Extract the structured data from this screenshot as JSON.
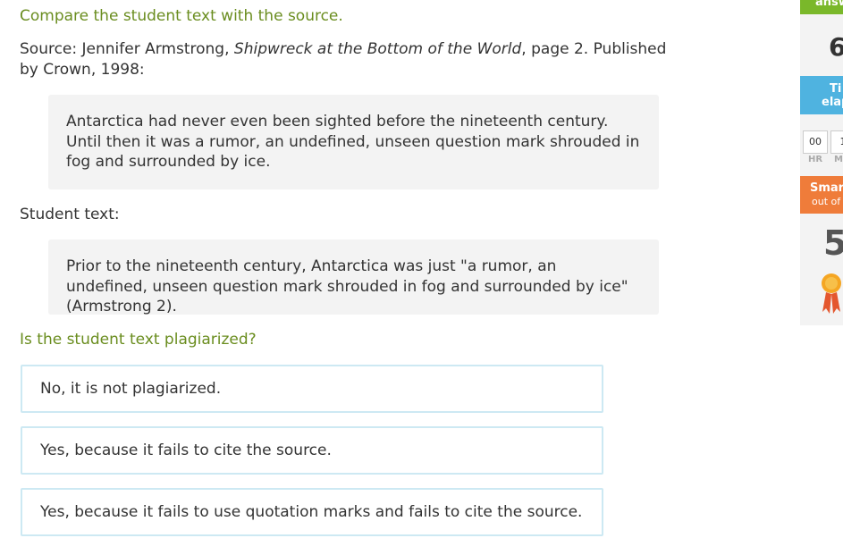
{
  "prompt": "Compare the student text with the source.",
  "source": {
    "prefix": "Source: Jennifer Armstrong, ",
    "title": "Shipwreck at the Bottom of the World",
    "suffix": ", page 2. Published by Crown, 1998:",
    "quote": "Antarctica had never even been sighted before the nineteenth century. Until then it was a rumor, an undefined, unseen question mark shrouded in fog and surrounded by ice."
  },
  "student": {
    "label": "Student text:",
    "quote": "Prior to the nineteenth century, Antarctica was just \"a rumor, an undefined, unseen question mark shrouded in fog and surrounded by ice\" (Armstrong 2)."
  },
  "question": "Is the student text plagiarized?",
  "choices": [
    "No, it is not plagiarized.",
    "Yes, because it fails to cite the source.",
    "Yes, because it fails to use quotation marks and fails to cite the source."
  ],
  "sidebar": {
    "answered_label": "answ",
    "answered_count": "6",
    "time_label_1": "Ti",
    "time_label_2": "elap",
    "hours": "00",
    "minutes": "1",
    "hours_label": "HR",
    "minutes_label": "M",
    "smart_label": "Smar",
    "smart_sub": "out of",
    "smart_score": "5"
  },
  "colors": {
    "green": "#6a8d1f",
    "answered_bg": "#7ab82a",
    "time_bg": "#4fb3e0",
    "smart_bg": "#ef7c3a",
    "choice_border": "#cde9f3"
  },
  "icons": {
    "ribbon": "award-ribbon-icon"
  }
}
